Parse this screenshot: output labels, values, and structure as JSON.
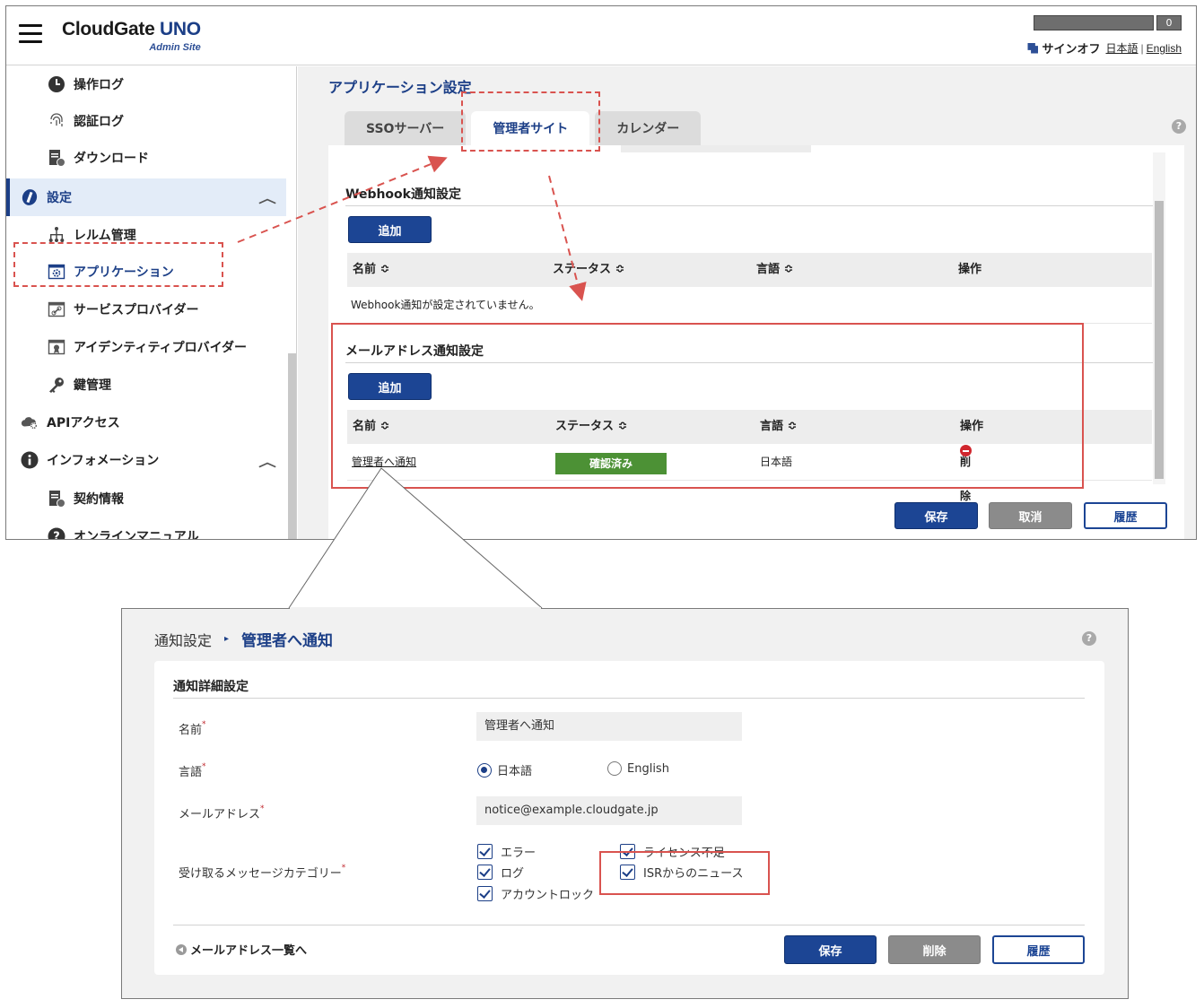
{
  "header": {
    "brand_main": "CloudGate",
    "brand_uno": "UNO",
    "brand_sub": "Admin Site",
    "user_count": "0",
    "signoff": "サインオフ",
    "lang_ja": "日本語",
    "lang_sep": "|",
    "lang_en": "English"
  },
  "sidebar": {
    "op_log": "操作ログ",
    "auth_log": "認証ログ",
    "download": "ダウンロード",
    "settings": "設定",
    "realm": "レルム管理",
    "application": "アプリケーション",
    "service_provider": "サービスプロバイダー",
    "identity_provider": "アイデンティティプロバイダー",
    "key_mgmt": "鍵管理",
    "api_access": "APIアクセス",
    "information": "インフォメーション",
    "contract": "契約情報",
    "manual": "オンラインマニュアル"
  },
  "main": {
    "title": "アプリケーション設定",
    "help": "?",
    "tabs": [
      "SSOサーバー",
      "管理者サイト",
      "カレンダー"
    ],
    "webhook": {
      "heading": "Webhook通知設定",
      "add": "追加",
      "columns": [
        "名前 ≎",
        "ステータス ≎",
        "言語 ≎",
        "操作"
      ],
      "empty": "Webhook通知が設定されていません。"
    },
    "mail": {
      "heading": "メールアドレス通知設定",
      "add": "追加",
      "columns": [
        "名前 ≎",
        "ステータス ≎",
        "言語 ≎",
        "操作"
      ],
      "row": {
        "name": "管理者へ通知",
        "status": "確認済み",
        "lang": "日本語",
        "op": "削除"
      }
    },
    "footer": {
      "save": "保存",
      "cancel": "取消",
      "history": "履歴"
    }
  },
  "detail": {
    "crumb_parent": "通知設定",
    "crumb_sep": "▸",
    "crumb_current": "管理者へ通知",
    "help": "?",
    "heading": "通知詳細設定",
    "req_mark": "*",
    "name_label": "名前",
    "name_value": "管理者へ通知",
    "lang_label": "言語",
    "lang_ja": "日本語",
    "lang_en": "English",
    "lang_selected": "日本語",
    "email_label": "メールアドレス",
    "email_value": "notice@example.cloudgate.jp",
    "category_label": "受け取るメッセージカテゴリー",
    "categories": [
      "エラー",
      "ログ",
      "アカウントロック",
      "ライセンス不足",
      "ISRからのニュース"
    ],
    "back": "メールアドレス一覧へ",
    "save": "保存",
    "delete": "削除",
    "history": "履歴"
  },
  "colors": {
    "primary": "#1c4594",
    "accent_text": "#1c3f87",
    "status_ok": "#4c9135",
    "annotation": "#d9534f",
    "danger": "#d0262d"
  }
}
